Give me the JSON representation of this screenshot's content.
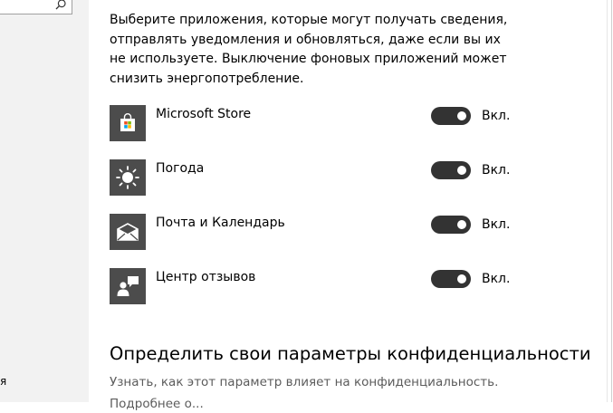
{
  "left_pane": {
    "fragment": "я"
  },
  "description": "Выберите приложения, которые могут получать сведения, отправлять уведомления и обновляться, даже если вы их не используете. Выключение фоновых приложений может снизить энергопотребление.",
  "apps": [
    {
      "name": "Microsoft Store",
      "icon": "store-icon",
      "state_label": "Вкл.",
      "on": true
    },
    {
      "name": "Погода",
      "icon": "weather-sun-icon",
      "state_label": "Вкл.",
      "on": true
    },
    {
      "name": "Почта и Календарь",
      "icon": "mail-icon",
      "state_label": "Вкл.",
      "on": true
    },
    {
      "name": "Центр отзывов",
      "icon": "feedback-hub-icon",
      "state_label": "Вкл.",
      "on": true
    }
  ],
  "privacy": {
    "heading": "Определить свои параметры конфиденциальности",
    "link": "Узнать, как этот параметр влияет на конфиденциальность.",
    "fragment": "Подробнее о..."
  },
  "colors": {
    "tile_bg": "#4c4c4c",
    "toggle_on": "#333333",
    "nav_bg": "#f2f2f2"
  }
}
